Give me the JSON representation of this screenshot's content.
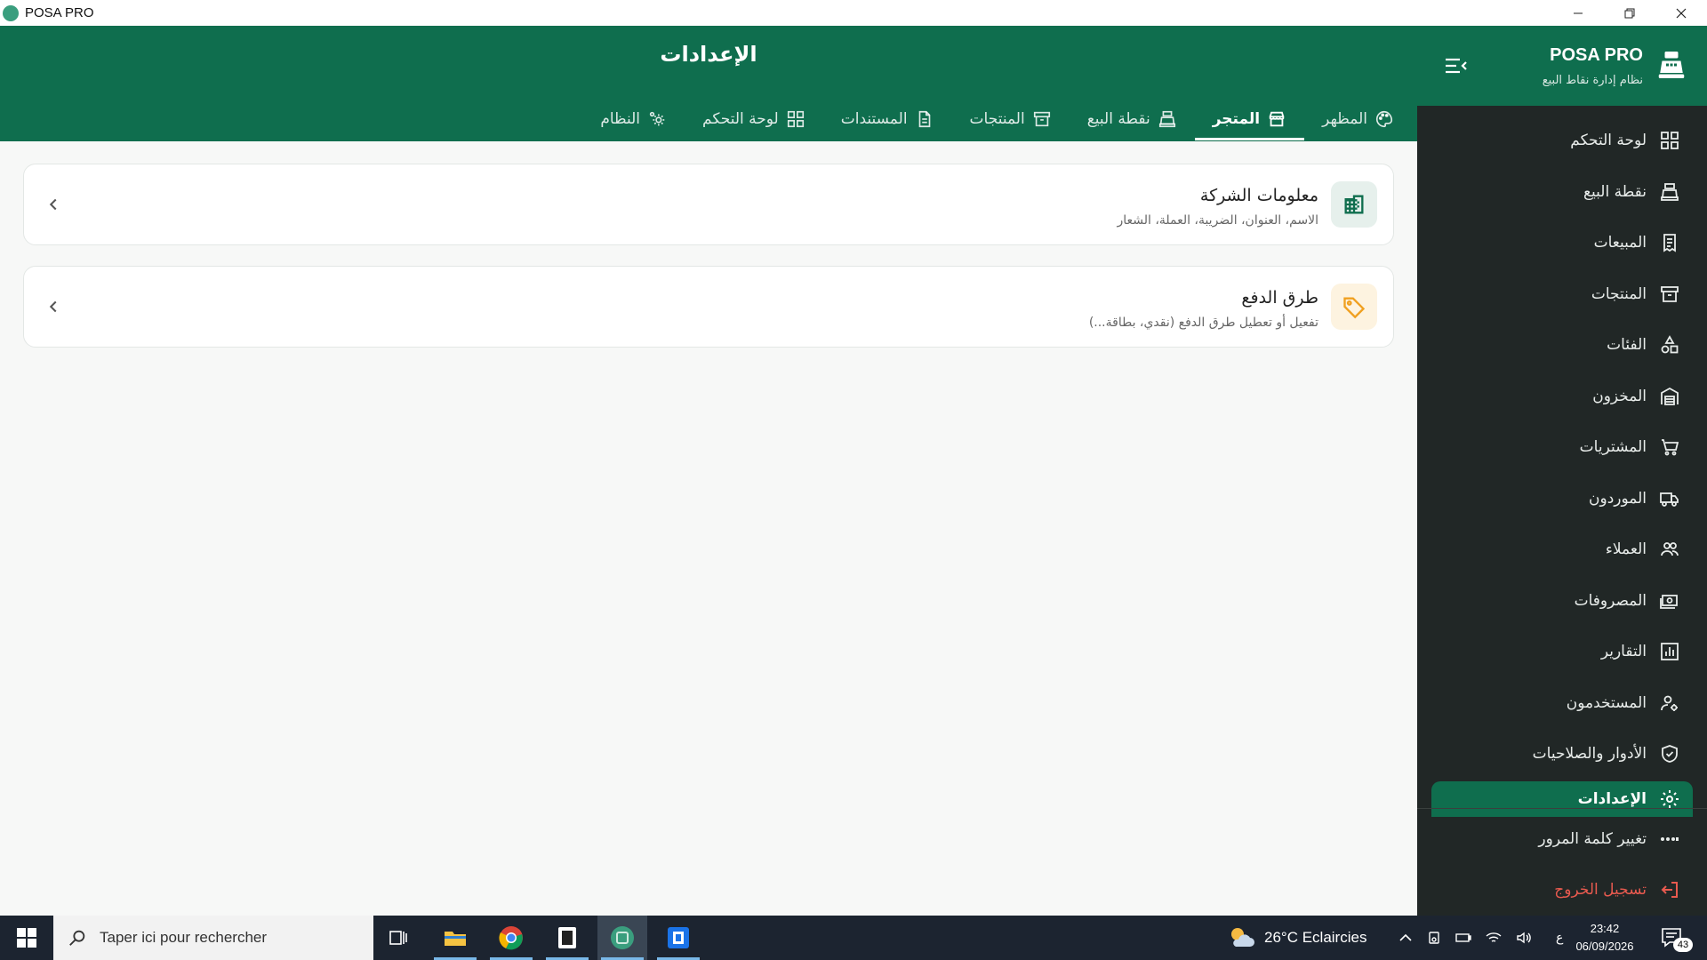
{
  "titlebar": {
    "app_name": "POSA PRO"
  },
  "header": {
    "title": "الإعدادات",
    "tabs": [
      {
        "label": "المظهر",
        "icon": "palette-icon",
        "active": false
      },
      {
        "label": "المتجر",
        "icon": "store-icon",
        "active": true
      },
      {
        "label": "نقطة البيع",
        "icon": "cash-register-icon",
        "active": false
      },
      {
        "label": "المنتجات",
        "icon": "archive-box-icon",
        "active": false
      },
      {
        "label": "المستندات",
        "icon": "document-icon",
        "active": false
      },
      {
        "label": "لوحة التحكم",
        "icon": "dashboard-icon",
        "active": false
      },
      {
        "label": "النظام",
        "icon": "cogs-icon",
        "active": false
      }
    ]
  },
  "cards": [
    {
      "title": "معلومات الشركة",
      "subtitle": "الاسم، العنوان، الضريبة، العملة، الشعار",
      "icon": "building-icon",
      "icon_color": "#0f6e4e",
      "icon_bg": "#e6f0ec"
    },
    {
      "title": "طرق الدفع",
      "subtitle": "تفعيل أو تعطيل طرق الدفع (نقدي، بطاقة...)",
      "icon": "tag-icon",
      "icon_color": "#f0a020",
      "icon_bg": "#fdf3e0"
    }
  ],
  "sidebar": {
    "brand": "POSA PRO",
    "brand_sub": "نظام إدارة نقاط البيع",
    "items": [
      {
        "label": "لوحة التحكم",
        "icon": "dashboard-icon"
      },
      {
        "label": "نقطة البيع",
        "icon": "cash-register-icon"
      },
      {
        "label": "المبيعات",
        "icon": "receipt-icon"
      },
      {
        "label": "المنتجات",
        "icon": "archive-box-icon"
      },
      {
        "label": "الفئات",
        "icon": "shapes-icon"
      },
      {
        "label": "المخزون",
        "icon": "warehouse-icon"
      },
      {
        "label": "المشتريات",
        "icon": "cart-icon"
      },
      {
        "label": "الموردون",
        "icon": "truck-icon"
      },
      {
        "label": "العملاء",
        "icon": "users-icon"
      },
      {
        "label": "المصروفات",
        "icon": "cash-icon"
      },
      {
        "label": "التقارير",
        "icon": "chart-icon"
      },
      {
        "label": "المستخدمون",
        "icon": "user-cog-icon"
      },
      {
        "label": "الأدوار والصلاحيات",
        "icon": "shield-icon"
      },
      {
        "label": "الإعدادات",
        "icon": "gear-icon"
      }
    ],
    "bottom": [
      {
        "label": "تغيير كلمة المرور",
        "icon": "password-icon"
      },
      {
        "label": "تسجيل الخروج",
        "icon": "logout-icon"
      }
    ]
  },
  "taskbar": {
    "search_placeholder": "Taper ici pour rechercher",
    "weather": "26°C  Eclaircies",
    "lang": "ع",
    "time": "23:42",
    "date": "06/09/2026",
    "notif_count": "43"
  },
  "colors": {
    "brand": "#0f6e4e",
    "sidebar_bg": "#212726",
    "logout": "#e85a4f"
  }
}
